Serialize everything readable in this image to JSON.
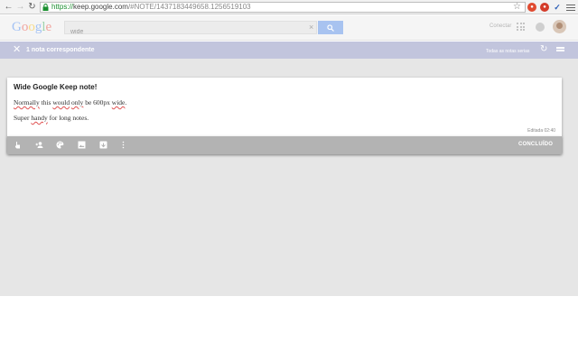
{
  "browser": {
    "url_scheme": "https://",
    "url_host": "keep.google.com",
    "url_path": "/#NOTE/1437183449658.1256519103"
  },
  "header": {
    "logo_letters": [
      "G",
      "o",
      "o",
      "g",
      "l",
      "e"
    ],
    "search_value": "wide",
    "signin_label": "Conectar"
  },
  "results": {
    "count_label": "1 nota correspondente",
    "all_notes_label": "Todas as notas serias"
  },
  "note": {
    "title": "Wide Google Keep note!",
    "line1_parts": [
      "Normally",
      " this ",
      "would",
      " ",
      "only",
      " be 600px ",
      "wide",
      "."
    ],
    "line2_parts": [
      "Super ",
      "handy",
      " for long notes."
    ],
    "edited": "Editada 02:40",
    "done_label": "CONCLUÍDO"
  },
  "colors": {
    "results_bar": "#c2c5dd",
    "note_toolbar": "#b3b3b3",
    "background": "#e6e6e6"
  },
  "icons": [
    "back-icon",
    "forward-icon",
    "reload-icon",
    "lock-icon",
    "star-icon",
    "close-icon",
    "refresh-icon",
    "list-view-icon",
    "reminder-icon",
    "collaborator-icon",
    "palette-icon",
    "image-icon",
    "archive-icon",
    "more-icon"
  ]
}
